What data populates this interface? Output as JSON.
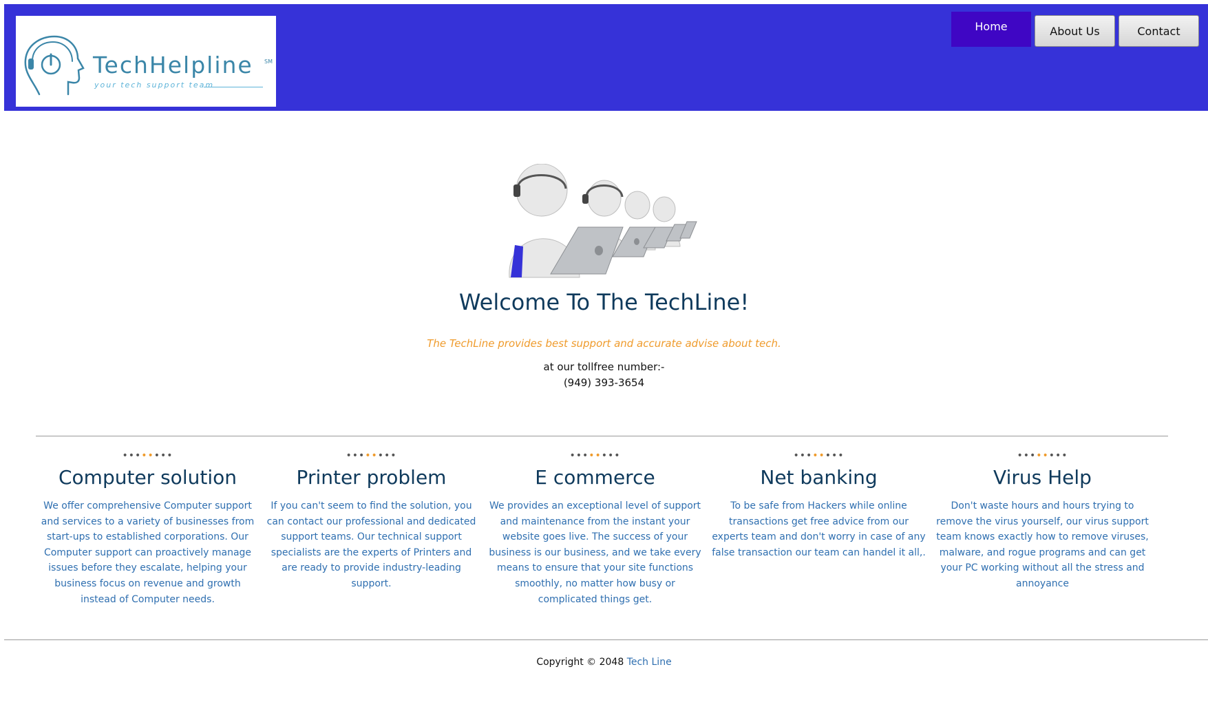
{
  "brand": {
    "name": "TechHelpline",
    "superscript": "SM",
    "tagline": "your tech support team"
  },
  "nav": {
    "home": "Home",
    "about": "About Us",
    "contact": "Contact"
  },
  "hero": {
    "title": "Welcome To The TechLine!",
    "tagline": "The TechLine provides best support and accurate advise about tech.",
    "toll_label": "at our tollfree number:-",
    "phone": "(949) 393-3654"
  },
  "services": [
    {
      "title": "Computer solution",
      "text": "We offer comprehensive Computer support and services to a variety of businesses from start-ups to established corporations. Our Computer support can proactively manage issues before they escalate, helping your business focus on revenue and growth instead of Computer needs."
    },
    {
      "title": "Printer problem",
      "text": "If you can't seem to find the solution, you can contact our professional and dedicated support teams. Our technical support specialists are the experts of Printers and are ready to provide industry-leading support."
    },
    {
      "title": "E commerce",
      "text": "We provides an exceptional level of support and maintenance from the instant your website goes live. The success of your business is our business, and we take every means to ensure that your site functions smoothly, no matter how busy or complicated things get."
    },
    {
      "title": "Net banking",
      "text": "To be safe from Hackers while online transactions get free advice from our experts team and don't worry in case of any false transaction our team can handel it all,."
    },
    {
      "title": "Virus Help",
      "text": "Don't waste hours and hours trying to remove the virus yourself, our virus support team knows exactly how to remove viruses, malware, and rogue programs and can get your PC working without all the stress and annoyance"
    }
  ],
  "footer": {
    "copyright": "Copyright © 2048",
    "link": "Tech Line"
  },
  "colors": {
    "header_bg": "#3632d8",
    "nav_active": "#3f06c4",
    "heading": "#0f3a5c",
    "accent_orange": "#ef9b2c",
    "body_blue": "#2f6fb0"
  }
}
